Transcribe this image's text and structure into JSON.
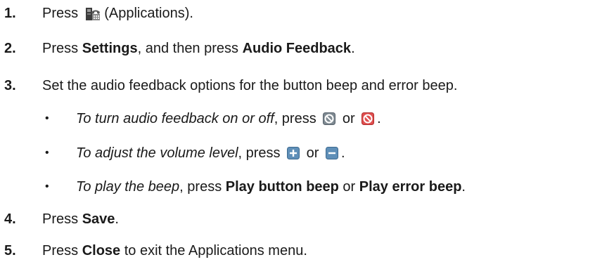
{
  "steps": [
    {
      "num": "1.",
      "pre": "Press ",
      "icon": "applications-phone-icon",
      "post": " (Applications)."
    },
    {
      "num": "2.",
      "pre": "Press ",
      "bold1": "Settings",
      "mid": ", and then press ",
      "bold2": "Audio Feedback",
      "post": "."
    },
    {
      "num": "3.",
      "text": "Set the audio feedback options for the button beep and error beep."
    },
    {
      "num": "4.",
      "pre": "Press ",
      "bold1": "Save",
      "post": "."
    },
    {
      "num": "5.",
      "pre": "Press ",
      "bold1": "Close",
      "post": " to exit the Applications menu."
    }
  ],
  "bullets": [
    {
      "mark": "•",
      "italic": "To turn audio feedback on or off",
      "pre": ", press ",
      "icon1": "audio-on-icon",
      "mid": " or ",
      "icon2": "audio-off-icon",
      "post": "."
    },
    {
      "mark": "•",
      "italic": "To adjust the volume level",
      "pre": ", press ",
      "icon1": "plus-icon",
      "mid": " or ",
      "icon2": "minus-icon",
      "post": "."
    },
    {
      "mark": "•",
      "italic": "To play the beep",
      "pre": ", press ",
      "bold1": "Play button beep",
      "mid": " or ",
      "bold2": "Play error beep",
      "post": "."
    }
  ]
}
